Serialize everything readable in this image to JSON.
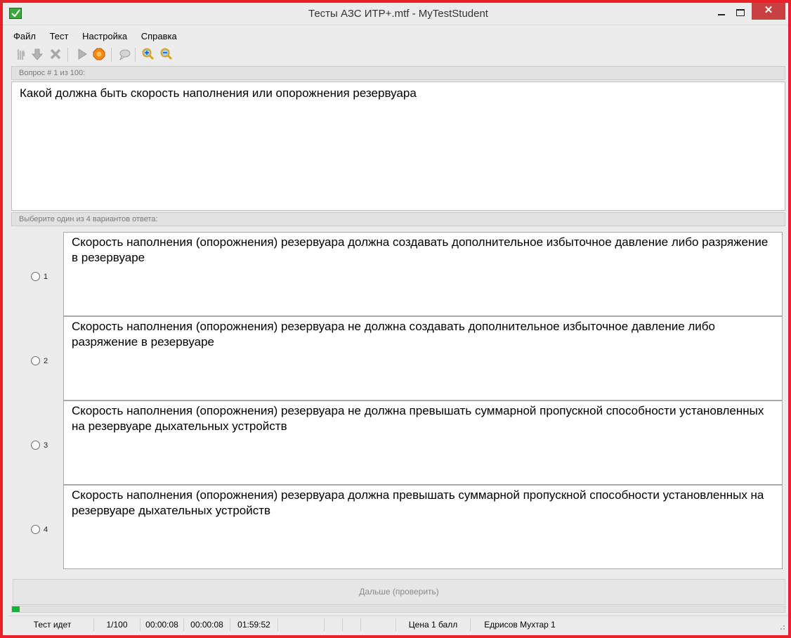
{
  "window": {
    "title": "Тесты АЗС ИТР+.mtf - MyTestStudent",
    "colors": {
      "frame": "#e8202a",
      "close_button": "#c94040",
      "progress": "#13b33a"
    }
  },
  "menu": {
    "items": [
      "Файл",
      "Тест",
      "Настройка",
      "Справка"
    ]
  },
  "toolbar": {
    "icons": [
      "hand-icon",
      "down-arrow-icon",
      "delete-icon",
      "play-icon",
      "stop-icon",
      "chat-icon",
      "zoom-in-icon",
      "zoom-out-icon"
    ]
  },
  "question": {
    "header": "Вопрос # 1 из 100:",
    "text": "Какой должна быть скорость наполнения или опорожнения резервуара"
  },
  "answers": {
    "header": "Выберите один из 4 вариантов ответа:",
    "options": [
      {
        "num": "1",
        "text": "Скорость наполнения (опорожнения) резервуара должна создавать дополнительное избыточное давление либо разряжение в резервуаре"
      },
      {
        "num": "2",
        "text": "Скорость наполнения (опорожнения) резервуара не должна создавать дополнительное избыточное давление либо разряжение в резервуаре"
      },
      {
        "num": "3",
        "text": "Скорость наполнения (опорожнения) резервуара не должна превышать суммарной пропускной способности установленных на резервуаре дыхательных устройств"
      },
      {
        "num": "4",
        "text": "Скорость наполнения (опорожнения) резервуара должна превышать суммарной пропускной способности установленных на резервуаре дыхательных устройств"
      }
    ]
  },
  "next_button": {
    "label": "Дальше (проверить)"
  },
  "progress": {
    "fraction": 0.01
  },
  "status": {
    "state": "Тест идет",
    "counter": "1/100",
    "time_question": "00:00:08",
    "time_total": "00:00:08",
    "time_left": "01:59:52",
    "price": "Цена 1 балл",
    "user": "Едрисов Мухтар 1"
  }
}
